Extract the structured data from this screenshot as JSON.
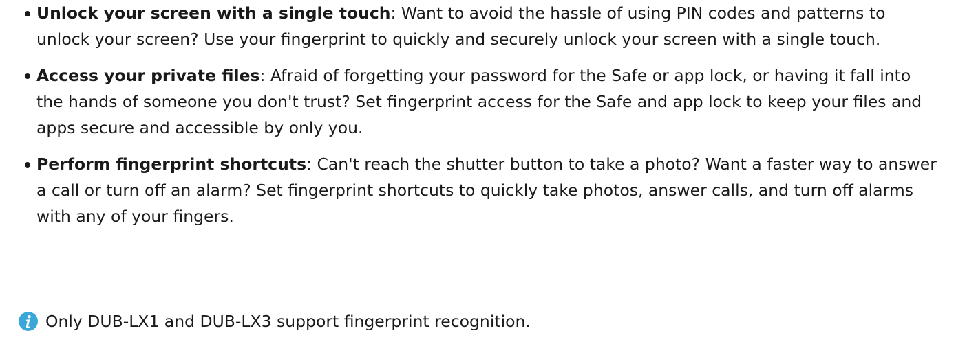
{
  "bullets": [
    {
      "title": "Unlock your screen with a single touch",
      "body": ": Want to avoid the hassle of using PIN codes and patterns to unlock your screen? Use your fingerprint to quickly and securely unlock your screen with a single touch."
    },
    {
      "title": "Access your private files",
      "body": ": Afraid of forgetting your password for the Safe or app lock, or having it fall into the hands of someone you don't trust? Set fingerprint access for the Safe and app lock to keep your files and apps secure and accessible by only you."
    },
    {
      "title": "Perform fingerprint shortcuts",
      "body": ": Can't reach the shutter button to take a photo? Want a faster way to answer a call or turn off an alarm? Set fingerprint shortcuts to quickly take photos, answer calls, and turn off alarms with any of your fingers."
    }
  ],
  "note": {
    "icon": "info-icon",
    "icon_color": "#3aa7d8",
    "text": "Only DUB-LX1 and DUB-LX3 support fingerprint recognition."
  }
}
